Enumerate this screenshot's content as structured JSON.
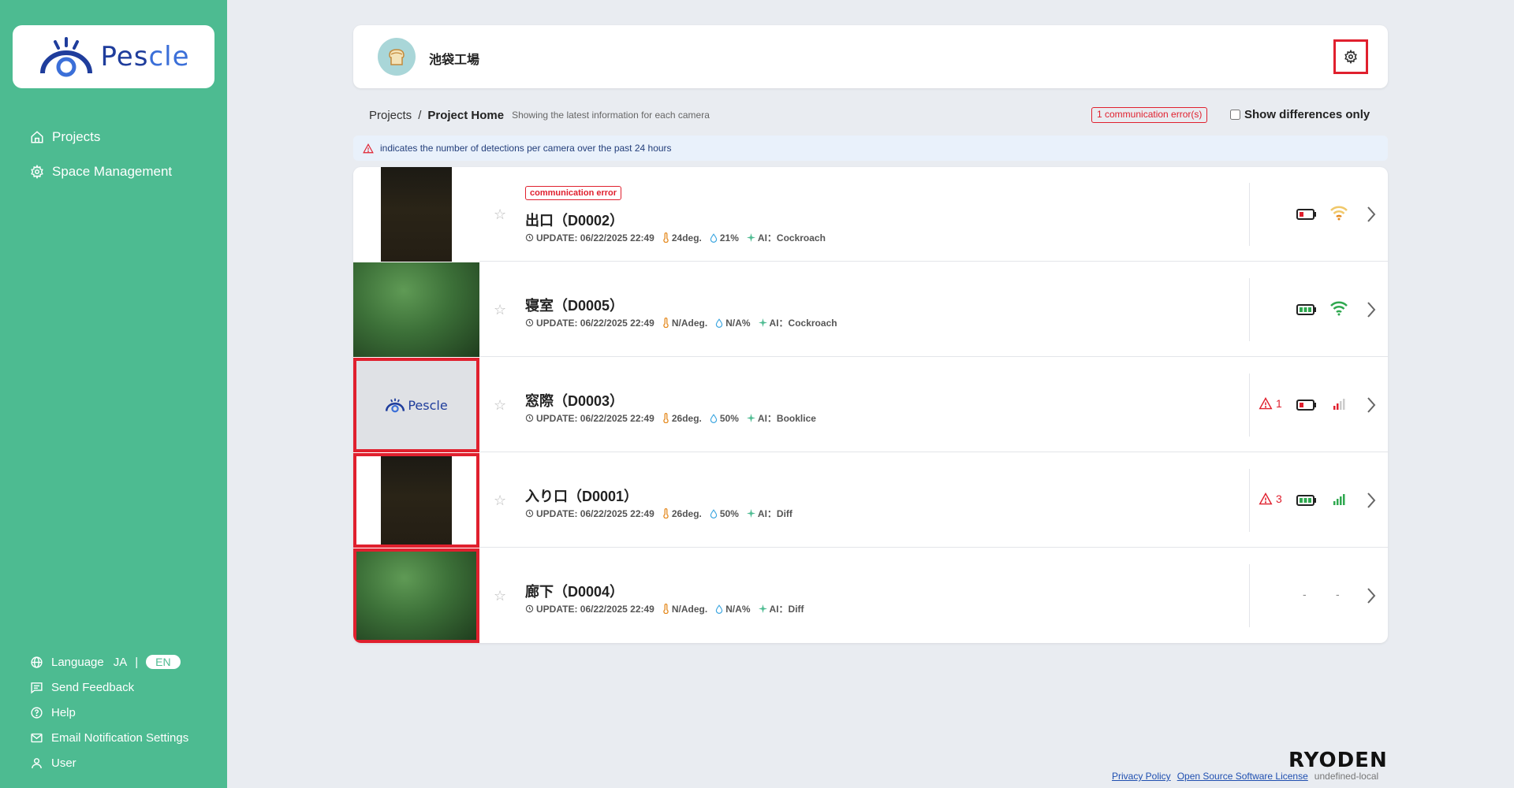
{
  "sidebar": {
    "logo_text": "Pescle",
    "nav": [
      {
        "label": "Projects",
        "icon": "home-icon"
      },
      {
        "label": "Space Management",
        "icon": "gear-icon"
      }
    ],
    "language_label": "Language",
    "lang_ja": "JA",
    "lang_sep": "|",
    "lang_en": "EN",
    "send_feedback": "Send Feedback",
    "help": "Help",
    "email_settings": "Email Notification Settings",
    "user": "User"
  },
  "header": {
    "factory_name": "池袋工場",
    "avatar_icon": "bread-icon",
    "settings_icon": "gear-icon"
  },
  "breadcrumb": {
    "projects": "Projects",
    "sep": "/",
    "current": "Project Home",
    "description": "Showing the latest information for each camera"
  },
  "error_badge": "1 communication error(s)",
  "show_diff_label": "Show differences only",
  "info_text": "indicates the number of detections per camera over the past 24 hours",
  "colors": {
    "accent": "#4dbb91",
    "error": "#e0202e",
    "brand": "#1f3d9c"
  },
  "cameras": [
    {
      "name": "出口（D0002）",
      "status": "communication error",
      "update": "UPDATE: 06/22/2025 22:49",
      "temp": "24deg.",
      "humidity": "21%",
      "ai": "AI：Cockroach",
      "detections": "",
      "battery": "low",
      "signal": "wifi-weak"
    },
    {
      "name": "寝室（D0005）",
      "status": "",
      "update": "UPDATE: 06/22/2025 22:49",
      "temp": "N/Adeg.",
      "humidity": "N/A%",
      "ai": "AI：Cockroach",
      "detections": "",
      "battery": "full",
      "signal": "wifi-strong"
    },
    {
      "name": "窓際（D0003）",
      "status": "",
      "update": "UPDATE: 06/22/2025 22:49",
      "temp": "26deg.",
      "humidity": "50%",
      "ai": "AI：Booklice",
      "detections": "1",
      "battery": "low",
      "signal": "bars-weak"
    },
    {
      "name": "入り口（D0001）",
      "status": "",
      "update": "UPDATE: 06/22/2025 22:49",
      "temp": "26deg.",
      "humidity": "50%",
      "ai": "AI：Diff",
      "detections": "3",
      "battery": "full",
      "signal": "bars-strong"
    },
    {
      "name": "廊下（D0004）",
      "status": "",
      "update": "UPDATE: 06/22/2025 22:49",
      "temp": "N/Adeg.",
      "humidity": "N/A%",
      "ai": "AI：Diff",
      "detections": "",
      "battery": "-",
      "signal": "-"
    }
  ],
  "footer": {
    "brand": "RYODEN",
    "privacy": "Privacy Policy",
    "oss": "Open Source Software License",
    "env": "undefined-local"
  }
}
